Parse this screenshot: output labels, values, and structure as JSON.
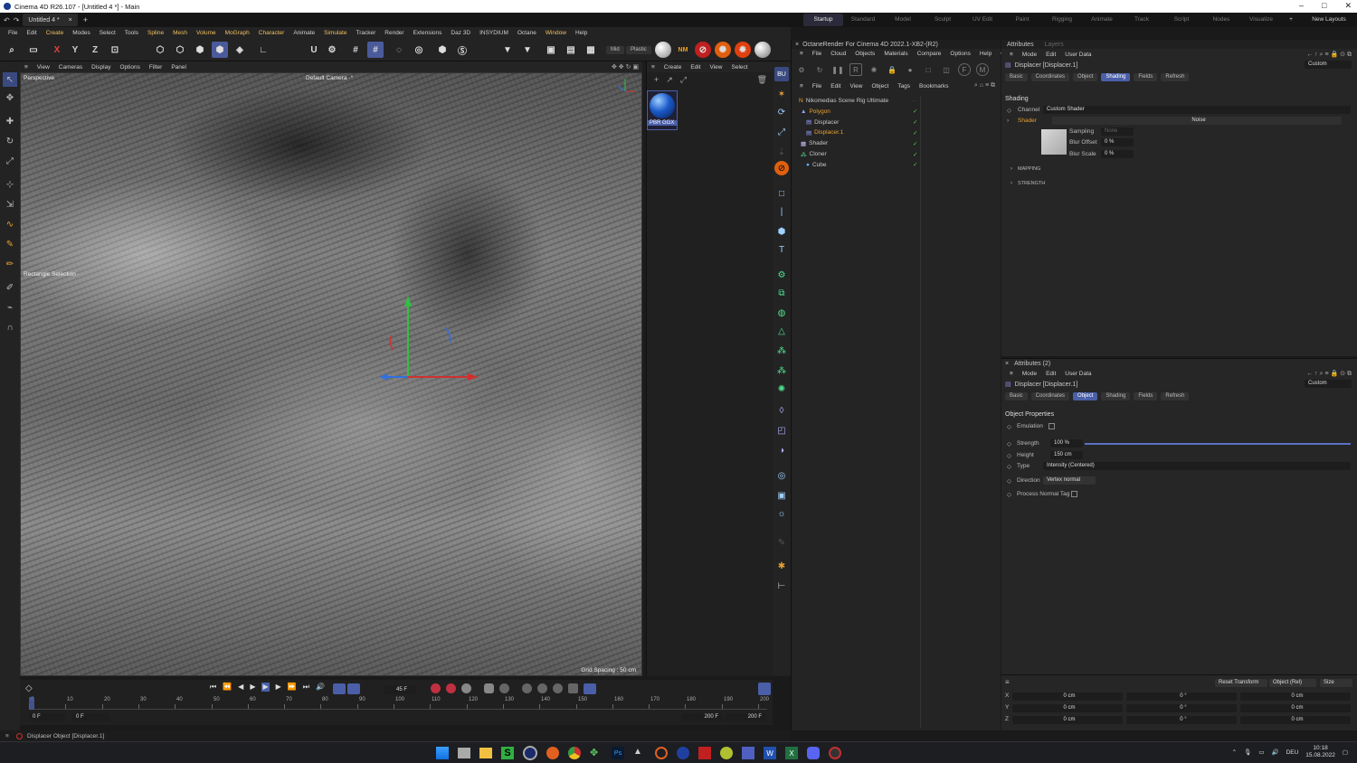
{
  "window": {
    "title": "Cinema 4D R26.107 - [Untitled 4 *] - Main",
    "controls": [
      "–",
      "□",
      "✕"
    ]
  },
  "tabs": {
    "doc_tab": "Untitled 4 *",
    "close": "×",
    "add": "+"
  },
  "layouts": [
    "Startup",
    "Standard",
    "Model",
    "Sculpt",
    "UV Edit",
    "Paint",
    "Rigging",
    "Animate",
    "Track",
    "Script",
    "Nodes",
    "Visualize"
  ],
  "layouts_add": "+",
  "new_layouts": "New Layouts",
  "menu": [
    "File",
    "Edit",
    "Create",
    "Modes",
    "Select",
    "Tools",
    "Spline",
    "Mesh",
    "Volume",
    "MoGraph",
    "Character",
    "Animate",
    "Simulate",
    "Tracker",
    "Render",
    "Extensions",
    "Daz 3D",
    "INSYDIUM",
    "Octane",
    "Window",
    "Help"
  ],
  "toolbar": {
    "x": "X",
    "y": "Y",
    "z": "Z",
    "mid": "Mid",
    "plastic": "Plastic"
  },
  "viewport": {
    "menu": [
      "View",
      "Cameras",
      "Display",
      "Options",
      "Filter",
      "Panel"
    ],
    "label": "Perspective",
    "camera": "Default Camera ·°",
    "rect_sel": "Rectangle Selection ·",
    "grid_spacing": "Grid Spacing : 50 cm"
  },
  "matmgr": {
    "menu": [
      "Create",
      "Edit",
      "View",
      "Select"
    ],
    "material_name": "PBR GGX"
  },
  "timeline": {
    "frame_field": "45 F",
    "ticks": [
      "0",
      "10",
      "20",
      "30",
      "40",
      "50",
      "60",
      "70",
      "80",
      "90",
      "100",
      "110",
      "120",
      "130",
      "140",
      "150",
      "160",
      "170",
      "180",
      "190",
      "200"
    ],
    "start1": "0 F",
    "start2": "0 F",
    "end1": "200 F",
    "end2": "200 F"
  },
  "status": "Displacer Object [Displacer.1]",
  "octane": {
    "title": "OctaneRender For Cinema 4D 2022.1-XB2-(R2)",
    "menu": [
      "File",
      "Cloud",
      "Objects",
      "Materials",
      "Compare",
      "Options",
      "Help",
      "GUI"
    ]
  },
  "objmgr": {
    "menu": [
      "File",
      "Edit",
      "View",
      "Object",
      "Tags",
      "Bookmarks"
    ],
    "objects": [
      {
        "name": "Nikomedias Scene Rig Ultimate",
        "color": "#c8c8c8"
      },
      {
        "name": "Polygon",
        "color": "#e8a030"
      },
      {
        "name": "Displacer",
        "color": "#c8c8c8"
      },
      {
        "name": "Displacer.1",
        "color": "#e8a030"
      },
      {
        "name": "Shader",
        "color": "#c8c8c8"
      },
      {
        "name": "Cloner",
        "color": "#c8c8c8"
      },
      {
        "name": "Cube",
        "color": "#c8c8c8"
      }
    ]
  },
  "attr1": {
    "tab": "Attributes",
    "tab2": "Layers",
    "menu": [
      "Mode",
      "Edit",
      "User Data"
    ],
    "object": "Displacer [Displacer.1]",
    "preset": "Custom",
    "buttons": [
      "Basic",
      "Coordinates",
      "Object",
      "Shading",
      "Fields",
      "Refresh"
    ],
    "active": "Shading",
    "section": "Shading",
    "channel_label": "Channel",
    "channel_value": "Custom Shader",
    "shader_label": "Shader",
    "shader_value": "Noise",
    "sampling_label": "Sampling",
    "sampling_value": "None",
    "blur_offset_label": "Blur Offset",
    "blur_offset_value": "0 %",
    "blur_scale_label": "Blur Scale",
    "blur_scale_value": "0 %",
    "mapping": "MAPPING",
    "strength": "STRENGTH"
  },
  "attr2": {
    "tab": "Attributes (2)",
    "menu": [
      "Mode",
      "Edit",
      "User Data"
    ],
    "object": "Displacer [Displacer.1]",
    "preset": "Custom",
    "buttons": [
      "Basic",
      "Coordinates",
      "Object",
      "Shading",
      "Fields",
      "Refresh"
    ],
    "active": "Object",
    "section": "Object Properties",
    "emulation_label": "Emulation",
    "strength_label": "Strength",
    "strength_value": "100 %",
    "strength_fraction": 1.0,
    "height_label": "Height",
    "height_value": "150 cm",
    "type_label": "Type",
    "type_value": "Intensity (Centered)",
    "direction_label": "Direction",
    "direction_value": "Vertex normal",
    "process_label": "Process Normal Tag"
  },
  "coords": {
    "reset": "Reset Transform",
    "object_rel": "Object (Rel)",
    "size": "Size",
    "rows": [
      {
        "axis": "X",
        "p": "0 cm",
        "r": "0 °",
        "s": "0 cm"
      },
      {
        "axis": "Y",
        "p": "0 cm",
        "r": "0 °",
        "s": "0 cm"
      },
      {
        "axis": "Z",
        "p": "0 cm",
        "r": "0 °",
        "s": "0 cm"
      }
    ]
  },
  "taskbar": {
    "lang": "DEU",
    "time": "10:18",
    "date": "15.08.2022"
  },
  "colors": {
    "accent": "#4a5fa8",
    "highlight": "#e8a030",
    "axis_red": "#d03030",
    "axis_green": "#30c040",
    "axis_blue": "#3070e0"
  }
}
